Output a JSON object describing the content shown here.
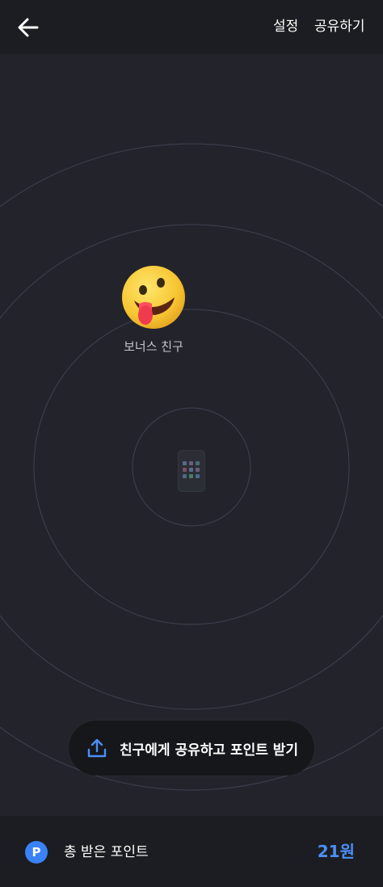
{
  "header": {
    "back_icon": "arrow-left-icon",
    "settings_label": "설정",
    "share_label": "공유하기"
  },
  "radar": {
    "friend": {
      "name": "보너스 친구",
      "avatar_icon": "tongue-out-emoji-icon"
    },
    "center_icon": "phone-device-icon",
    "share_button": {
      "label": "친구에게 공유하고 포인트 받기",
      "icon": "upload-share-icon"
    }
  },
  "footer": {
    "badge_text": "P",
    "label": "총 받은 포인트",
    "value": "21원"
  },
  "colors": {
    "background": "#23242b",
    "bar": "#1c1d22",
    "accent": "#4a8ff7",
    "ring": "#3e4150"
  }
}
